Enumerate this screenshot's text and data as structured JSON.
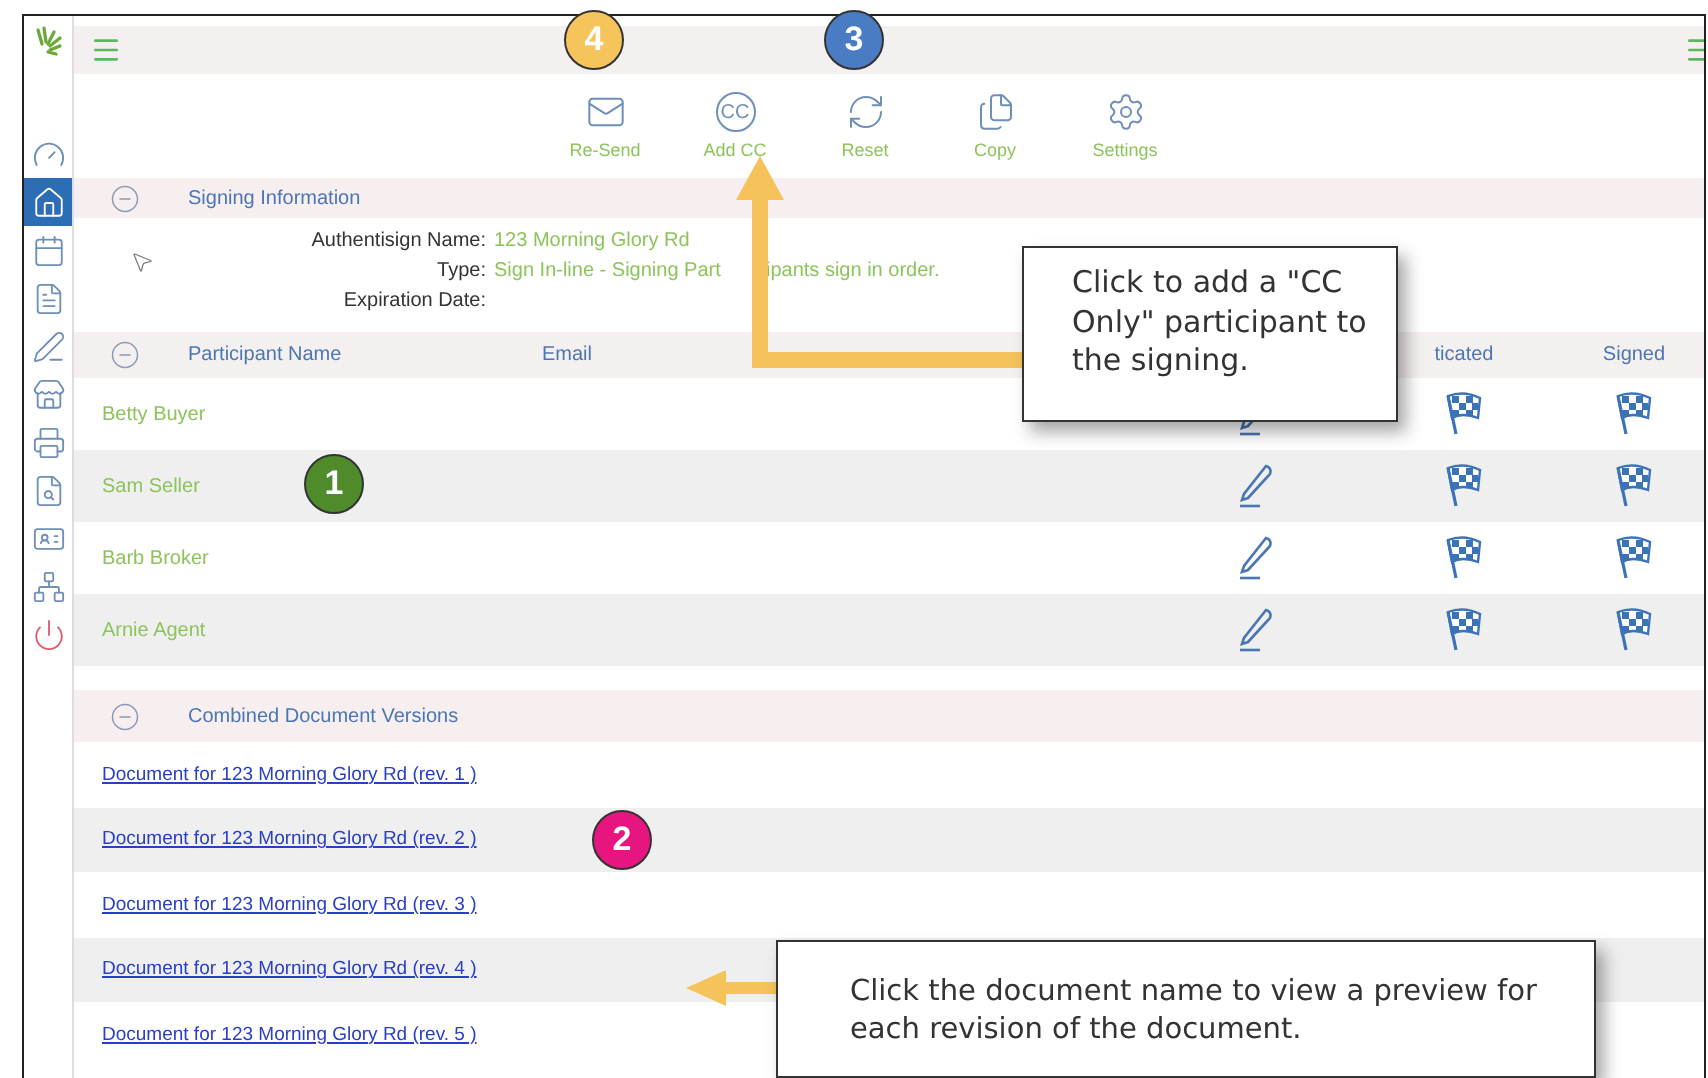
{
  "sidebar": {
    "items": [
      {
        "selected": false
      },
      {
        "selected": true
      },
      {
        "selected": false
      },
      {
        "selected": false
      },
      {
        "selected": false
      },
      {
        "selected": false
      },
      {
        "selected": false
      },
      {
        "selected": false
      },
      {
        "selected": false
      },
      {
        "selected": false
      },
      {
        "selected": false
      }
    ]
  },
  "toolbar": {
    "buttons": [
      {
        "label": "Re-Send"
      },
      {
        "label": "Add CC",
        "glyph": "CC"
      },
      {
        "label": "Reset"
      },
      {
        "label": "Copy"
      },
      {
        "label": "Settings"
      }
    ]
  },
  "signing_info": {
    "title": "Signing Information",
    "expanded": true,
    "fields": [
      {
        "label": "Authentisign Name:",
        "value": "123 Morning Glory Rd"
      },
      {
        "label": "Type:",
        "value_parts": [
          "Sign In-line - Signing Part",
          "ipants sign in order."
        ]
      },
      {
        "label": "Expiration Date:"
      }
    ]
  },
  "participants": {
    "expanded": true,
    "columns": [
      "Participant Name",
      "Email",
      "ticated",
      "Signed"
    ],
    "rows": [
      {
        "name": "Betty Buyer"
      },
      {
        "name": "Sam Seller"
      },
      {
        "name": "Barb Broker"
      },
      {
        "name": "Arnie Agent"
      }
    ]
  },
  "documents": {
    "title": "Combined Document Versions",
    "expanded": true,
    "links": [
      "Document for 123 Morning Glory Rd (rev. 1 )",
      "Document for 123 Morning Glory Rd (rev. 2 )",
      "Document for 123 Morning Glory Rd (rev. 3 )",
      "Document for 123 Morning Glory Rd (rev. 4 )",
      "Document for 123 Morning Glory Rd (rev. 5 )"
    ]
  },
  "annotations": {
    "badges": [
      {
        "number": "4",
        "color": "#f5c55c"
      },
      {
        "number": "3",
        "color": "#4a7cc4"
      },
      {
        "number": "1",
        "color": "#4f8a2b"
      },
      {
        "number": "2",
        "color": "#e6157f"
      }
    ],
    "callouts": [
      "Click to add a \"CC Only\" participant to the signing.",
      "Click the document name to view a preview for each revision of the document."
    ]
  }
}
